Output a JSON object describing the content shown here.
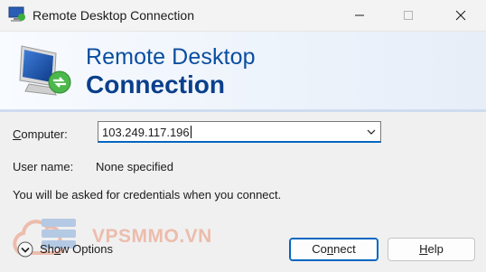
{
  "window": {
    "title": "Remote Desktop Connection",
    "controls": {
      "minimize": "minimize-icon",
      "maximize": "maximize-icon",
      "close": "close-icon"
    }
  },
  "banner": {
    "line1": "Remote Desktop",
    "line2": "Connection",
    "icon": "remote-desktop-monitor-icon"
  },
  "form": {
    "computer_label_prefix": "C",
    "computer_label_rest": "omputer:",
    "computer_value": "103.249.117.196",
    "username_label": "User name:",
    "username_value": "None specified",
    "info": "You will be asked for credentials when you connect."
  },
  "watermark": {
    "text": "VPSMMO.VN",
    "color": "#e98a6a"
  },
  "footer": {
    "show_options_prefix": "Sh",
    "show_options_underlined": "o",
    "show_options_rest": "w Options",
    "connect_prefix": "Co",
    "connect_underlined": "n",
    "connect_rest": "nect",
    "help_underlined": "H",
    "help_rest": "elp"
  },
  "colors": {
    "accent": "#0067c0",
    "banner_text": "#0a4ea0"
  }
}
